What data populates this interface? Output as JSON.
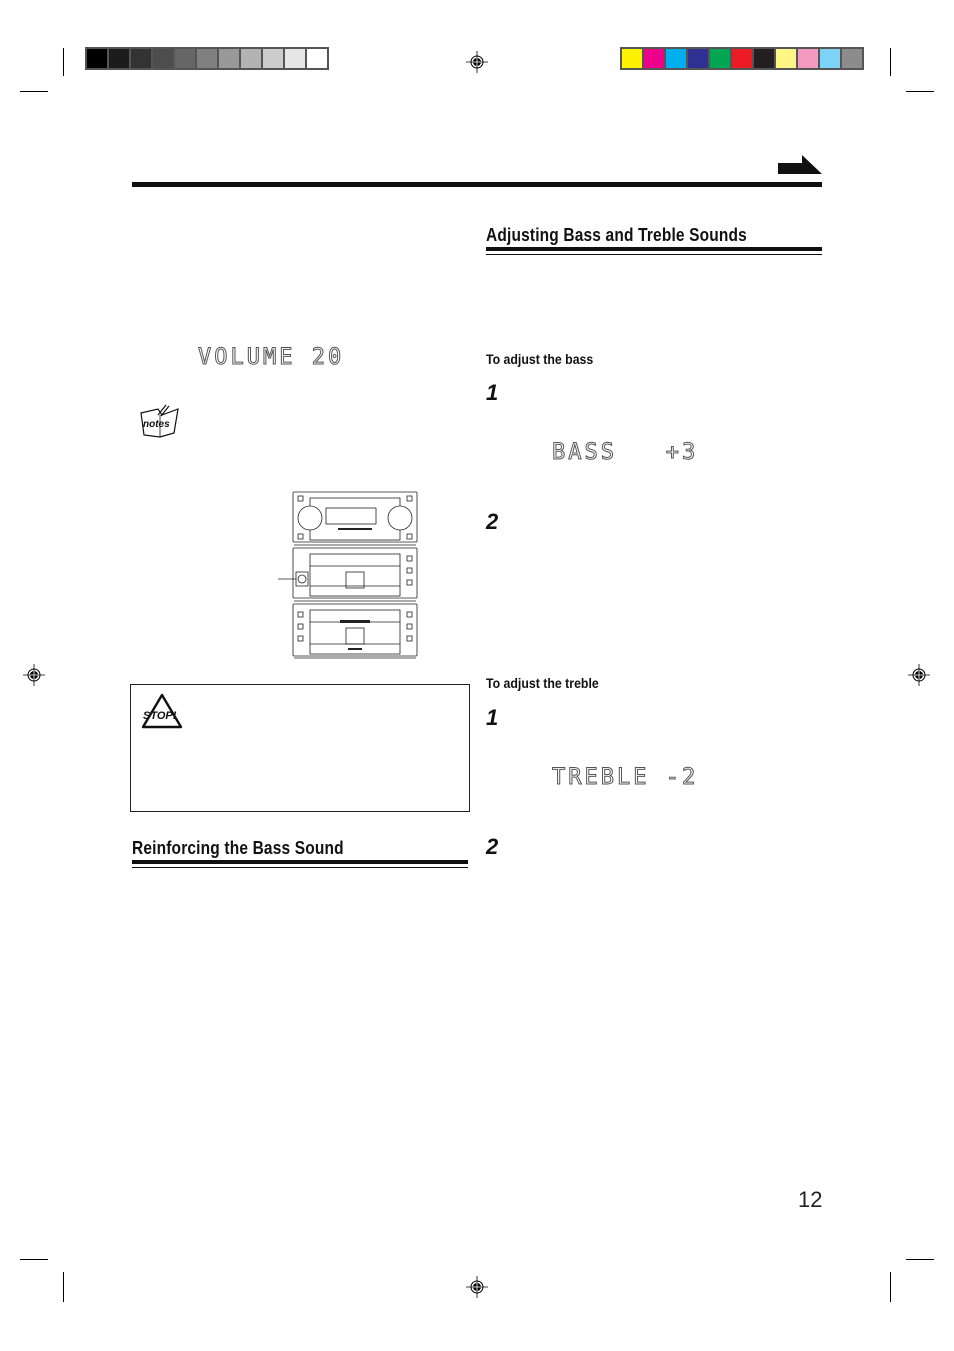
{
  "print_marks": {
    "grayscale_swatches": [
      "#000000",
      "#1c1c1c",
      "#333333",
      "#4d4d4d",
      "#666666",
      "#808080",
      "#999999",
      "#b3b3b3",
      "#cccccc",
      "#e6e6e6",
      "#ffffff"
    ],
    "color_swatches": [
      "#fff200",
      "#ec008c",
      "#00aeef",
      "#2e3192",
      "#00a651",
      "#ed1c24",
      "#231f20",
      "#fff685",
      "#f49ac1",
      "#7dd3f7",
      "#8c8c8c"
    ]
  },
  "header": {
    "continue_arrow_icon": "arrow-right"
  },
  "left_column": {
    "lcd_volume": "VOLUME 20",
    "notes_icon_label": "notes",
    "stop_icon_label": "STOP!",
    "section_reinforcing": {
      "title": "Reinforcing the Bass Sound"
    }
  },
  "right_column": {
    "section_adjusting": {
      "title": "Adjusting Bass and Treble Sounds",
      "bass": {
        "subtitle": "To adjust the bass",
        "steps": [
          "1",
          "2"
        ],
        "lcd": "BASS   +3"
      },
      "treble": {
        "subtitle": "To adjust the treble",
        "steps": [
          "1",
          "2"
        ],
        "lcd": "TREBLE -2"
      }
    }
  },
  "footer": {
    "page_number": "12"
  }
}
